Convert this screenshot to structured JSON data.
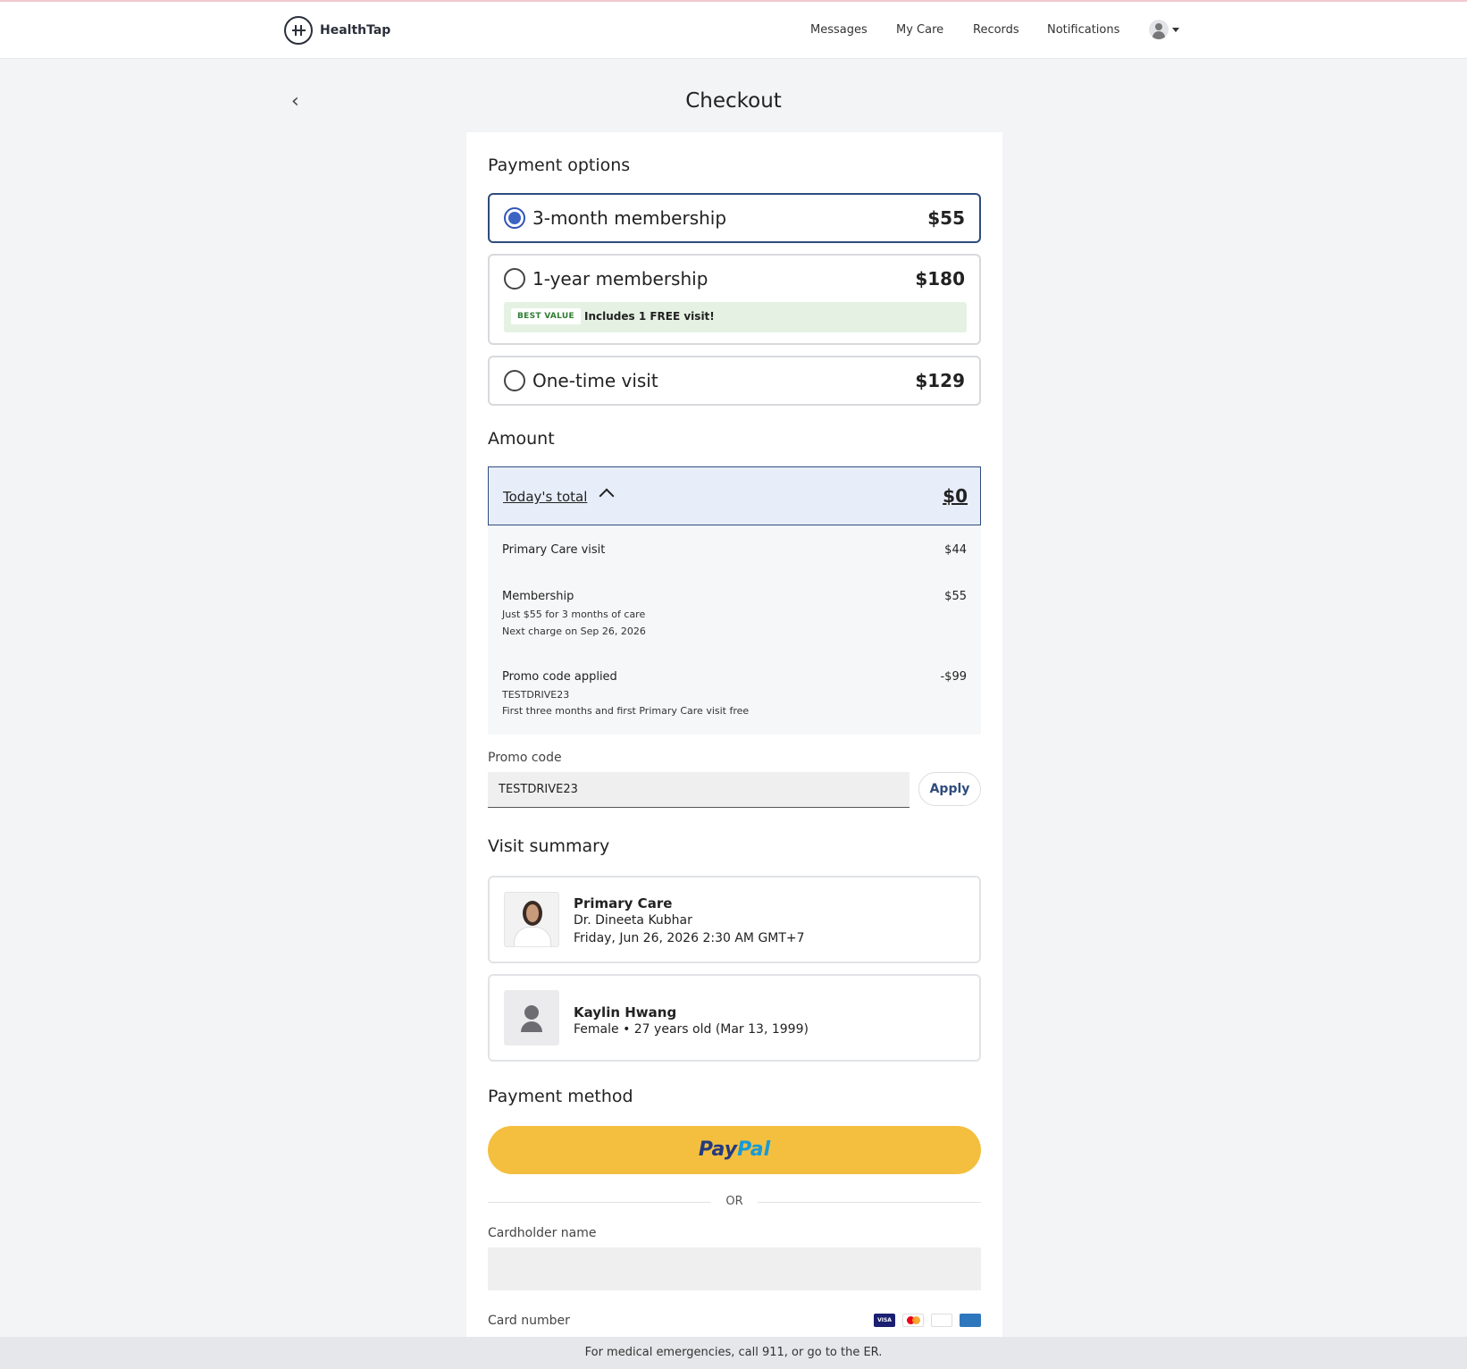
{
  "header": {
    "logo_text": "HealthTap",
    "nav": [
      "Messages",
      "My Care",
      "Records",
      "Notifications"
    ]
  },
  "page": {
    "title": "Checkout"
  },
  "payment_options": {
    "heading": "Payment options",
    "options": [
      {
        "label": "3-month membership",
        "price": "$55",
        "selected": true
      },
      {
        "label": "1-year membership",
        "price": "$180",
        "selected": false,
        "badge": "BEST VALUE",
        "badge_text": "Includes 1 FREE visit!"
      },
      {
        "label": "One-time visit",
        "price": "$129",
        "selected": false
      }
    ]
  },
  "amount": {
    "heading": "Amount",
    "total_label": "Today's total",
    "total_value": "$0",
    "lines": [
      {
        "title": "Primary Care visit",
        "amount": "$44",
        "sub": []
      },
      {
        "title": "Membership",
        "amount": "$55",
        "sub": [
          "Just $55 for 3 months of care",
          "Next charge on Sep 26, 2026"
        ]
      },
      {
        "title": "Promo code applied",
        "amount": "-$99",
        "sub": [
          "TESTDRIVE23",
          "First three months and first Primary Care visit free"
        ]
      }
    ]
  },
  "promo": {
    "label": "Promo code",
    "value": "TESTDRIVE23",
    "apply_label": "Apply"
  },
  "visit_summary": {
    "heading": "Visit summary",
    "visit": {
      "title": "Primary Care",
      "doctor": "Dr. Dineeta Kubhar",
      "datetime": "Friday, Jun 26, 2026 2:30 AM GMT+7"
    },
    "patient": {
      "name": "Kaylin Hwang",
      "details": "Female • 27 years old (Mar 13, 1999)"
    }
  },
  "payment_method": {
    "heading": "Payment method",
    "paypal_pay": "Pay",
    "paypal_pal": "Pal",
    "or_text": "OR",
    "cardholder_label": "Cardholder name",
    "card_number_label": "Card number",
    "card_icons": [
      "VISA",
      "mastercard",
      "DISCOVER",
      "AMEX"
    ]
  },
  "footer": {
    "text": "For medical emergencies, call 911, or go to the ER."
  }
}
